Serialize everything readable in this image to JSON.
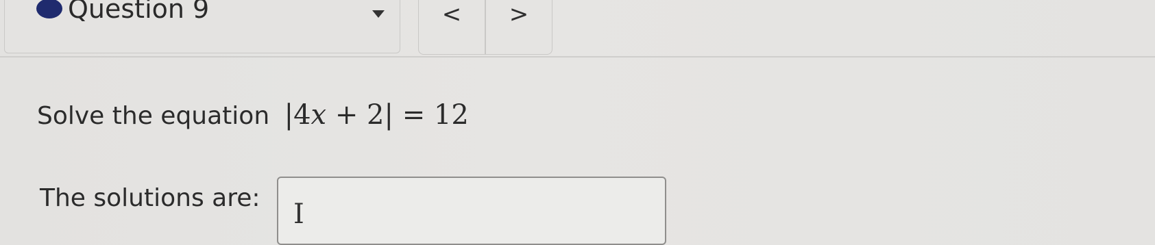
{
  "header": {
    "question_label": "Question 9",
    "status_color": "#1f2b6e",
    "dropdown_icon": "caret-down-icon",
    "nav": {
      "prev_label": "<",
      "next_label": ">"
    }
  },
  "question": {
    "prompt_text": "Solve the equation",
    "equation": {
      "abs_open": "|",
      "coefficient": "4",
      "variable": "x",
      "operator": "+",
      "constant": "2",
      "abs_close": "|",
      "equals": "=",
      "rhs": "12"
    }
  },
  "answer": {
    "label": "The solutions are:",
    "value": "",
    "cursor_glyph": "I"
  }
}
